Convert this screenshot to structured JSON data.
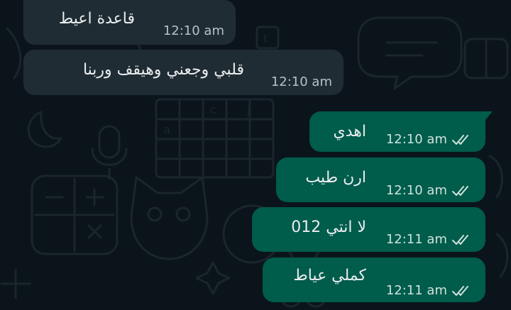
{
  "chat": {
    "messages": [
      {
        "direction": "incoming",
        "text": "قاعدة اعيط",
        "time": "12:10 am"
      },
      {
        "direction": "incoming",
        "text": "قلبي وجعني وهيقف وربنا",
        "time": "12:10 am"
      },
      {
        "direction": "outgoing",
        "text": "اهدي",
        "time": "12:10 am",
        "status": "read"
      },
      {
        "direction": "outgoing",
        "text": "ارن طيب",
        "time": "12:10 am",
        "status": "read"
      },
      {
        "direction": "outgoing",
        "text": "لا انتي 012",
        "time": "12:11 am",
        "status": "read"
      },
      {
        "direction": "outgoing",
        "text": "كملي عياط",
        "time": "12:11 am",
        "status": "read"
      }
    ]
  },
  "icons": {
    "status_icon": "double-check-icon"
  },
  "colors": {
    "background": "#0b141a",
    "incoming_bubble": "#202c33",
    "outgoing_bubble": "#005c4b",
    "text": "#e9edef",
    "time_incoming": "#b8c1c6",
    "time_outgoing": "#cfe3dc"
  }
}
